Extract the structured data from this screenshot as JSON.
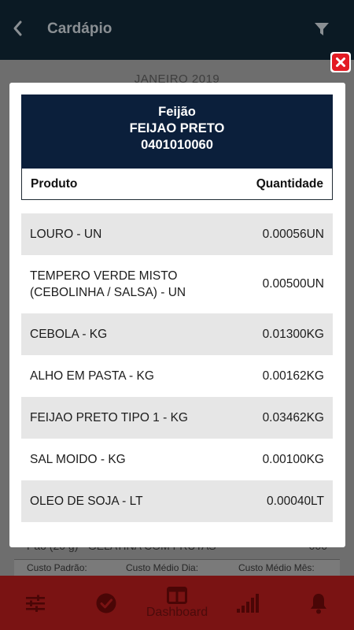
{
  "appbar": {
    "title": "Cardápio"
  },
  "background": {
    "month": "JANEIRO 2019",
    "row_text": "Pão (20 g) - GELATINA COM FRUTAS",
    "row_value": "000",
    "costs": [
      "Custo Padrão:",
      "Custo Médio Dia:",
      "Custo Médio Mês:"
    ]
  },
  "modal": {
    "header": {
      "line1": "Feijão",
      "line2": "FEIJAO PRETO",
      "line3": "0401010060"
    },
    "columns": {
      "product": "Produto",
      "quantity": "Quantidade"
    },
    "rows": [
      {
        "product": "LOURO - UN",
        "quantity": "0.00056UN"
      },
      {
        "product": "TEMPERO VERDE MISTO (CEBOLINHA / SALSA) - UN",
        "quantity": "0.00500UN"
      },
      {
        "product": "CEBOLA - KG",
        "quantity": "0.01300KG"
      },
      {
        "product": "ALHO EM PASTA - KG",
        "quantity": "0.00162KG"
      },
      {
        "product": "FEIJAO PRETO TIPO 1 - KG",
        "quantity": "0.03462KG"
      },
      {
        "product": "SAL MOIDO - KG",
        "quantity": "0.00100KG"
      },
      {
        "product": "OLEO DE SOJA - LT",
        "quantity": "0.00040LT"
      }
    ]
  },
  "bottomnav": {
    "dashboard_label": "Dashboard"
  },
  "icons": [
    "back-icon",
    "filter-icon",
    "close-icon",
    "settings-sliders-icon",
    "check-circle-icon",
    "dashboard-icon",
    "signal-bars-icon",
    "bell-icon"
  ],
  "colors": {
    "appbar": "#0b1a24",
    "modal_header": "#0b1f3b",
    "bottomnav": "#7a1313",
    "close": "#e31b23",
    "row_alt": "#e6e6e6"
  }
}
